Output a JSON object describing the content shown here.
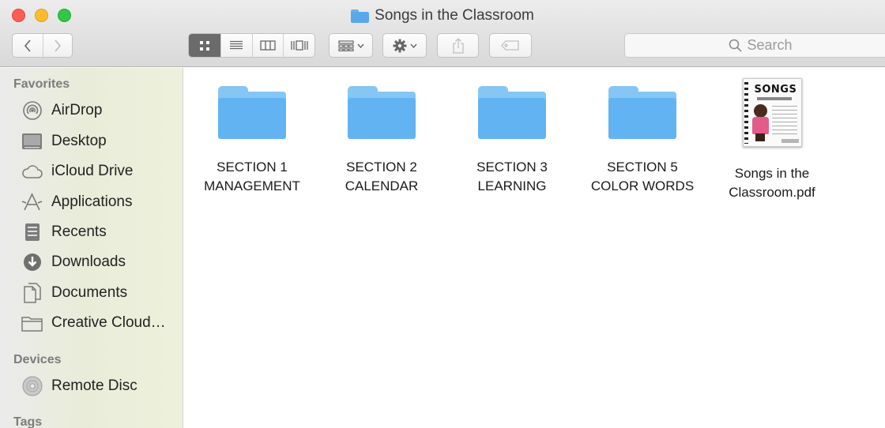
{
  "window": {
    "title": "Songs in the Classroom",
    "title_icon": "folder-icon"
  },
  "toolbar": {
    "back_icon": "‹",
    "forward_icon": "›",
    "view_modes": [
      {
        "name": "icon-view",
        "icon": "grid-icon",
        "selected": true
      },
      {
        "name": "list-view",
        "icon": "list-icon",
        "selected": false
      },
      {
        "name": "column-view",
        "icon": "columns-icon",
        "selected": false
      },
      {
        "name": "gallery-view",
        "icon": "cover-flow-icon",
        "selected": false
      }
    ],
    "arrange_icon": "group-icon",
    "action_icon": "gear-icon",
    "share_icon": "share-icon",
    "tags_icon": "tag-icon",
    "search_placeholder": "Search"
  },
  "sidebar": {
    "favorites_heading": "Favorites",
    "favorites": [
      {
        "label": "AirDrop",
        "icon": "airdrop-icon"
      },
      {
        "label": "Desktop",
        "icon": "desktop-icon"
      },
      {
        "label": "iCloud Drive",
        "icon": "cloud-icon"
      },
      {
        "label": "Applications",
        "icon": "applications-icon"
      },
      {
        "label": "Recents",
        "icon": "recents-icon"
      },
      {
        "label": "Downloads",
        "icon": "downloads-icon"
      },
      {
        "label": "Documents",
        "icon": "documents-icon"
      },
      {
        "label": "Creative Cloud…",
        "icon": "folder-icon"
      }
    ],
    "devices_heading": "Devices",
    "devices": [
      {
        "label": "Remote Disc",
        "icon": "disc-icon"
      }
    ],
    "tags_heading": "Tags"
  },
  "content": {
    "items": [
      {
        "kind": "folder",
        "line1": "SECTION 1",
        "line2": "MANAGEMENT"
      },
      {
        "kind": "folder",
        "line1": "SECTION 2",
        "line2": "CALENDAR"
      },
      {
        "kind": "folder",
        "line1": "SECTION 3",
        "line2": "LEARNING"
      },
      {
        "kind": "folder",
        "line1": "SECTION 5",
        "line2": "COLOR WORDS"
      },
      {
        "kind": "pdf",
        "line1": "Songs in the",
        "line2": "Classroom.pdf",
        "thumb_text": "SONGS"
      }
    ]
  },
  "colors": {
    "folder_blue": "#62b3f1",
    "close": "#fc5d57",
    "minimize": "#fdbc2e",
    "maximize": "#33c748"
  }
}
